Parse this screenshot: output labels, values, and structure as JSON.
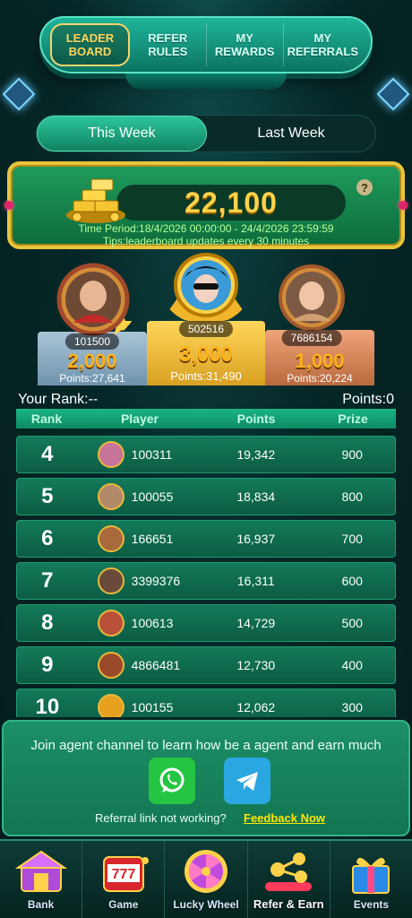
{
  "top_tabs": [
    {
      "label": "LEADER BOARD",
      "active": true
    },
    {
      "label": "REFER RULES",
      "active": false
    },
    {
      "label": "MY REWARDS",
      "active": false
    },
    {
      "label": "MY REFERRALS",
      "active": false
    }
  ],
  "week_toggle": {
    "this_week": "This Week",
    "last_week": "Last Week",
    "selected": "This Week"
  },
  "prize_banner": {
    "amount": "22,100",
    "help": "?",
    "time_period": "Time Period:18/4/2026 00:00:00 - 24/4/2026 23:59:59",
    "tips": "Tips:leaderboard updates every 30 minutes"
  },
  "podium": {
    "first": {
      "id": "502516",
      "prize": "3,000",
      "points": "Points:31,490"
    },
    "second": {
      "id": "101500",
      "prize": "2,000",
      "points": "Points:27,641"
    },
    "third": {
      "id": "7686154",
      "prize": "1,000",
      "points": "Points:20,224"
    }
  },
  "my_rank": {
    "rank_label": "Your Rank:--",
    "points_label": "Points:0"
  },
  "table": {
    "headers": {
      "rank": "Rank",
      "player": "Player",
      "points": "Points",
      "prize": "Prize"
    },
    "rows": [
      {
        "rank": "4",
        "player": "100311",
        "points": "19,342",
        "prize": "900"
      },
      {
        "rank": "5",
        "player": "100055",
        "points": "18,834",
        "prize": "800"
      },
      {
        "rank": "6",
        "player": "166651",
        "points": "16,937",
        "prize": "700"
      },
      {
        "rank": "7",
        "player": "3399376",
        "points": "16,311",
        "prize": "600"
      },
      {
        "rank": "8",
        "player": "100613",
        "points": "14,729",
        "prize": "500"
      },
      {
        "rank": "9",
        "player": "4866481",
        "points": "12,730",
        "prize": "400"
      },
      {
        "rank": "10",
        "player": "100155",
        "points": "12,062",
        "prize": "300"
      }
    ]
  },
  "agent_panel": {
    "message": "Join agent channel to learn how be a agent and earn much",
    "whatsapp_icon": "whatsapp-icon",
    "telegram_icon": "telegram-icon",
    "referral_text": "Referral link not working?",
    "feedback_link": "Feedback Now"
  },
  "bottom_nav": [
    {
      "label": "Bank",
      "icon": "bank-icon"
    },
    {
      "label": "Game",
      "icon": "slot-machine-icon"
    },
    {
      "label": "Lucky Wheel",
      "icon": "wheel-icon"
    },
    {
      "label": "Refer & Earn",
      "icon": "refer-icon",
      "active": true
    },
    {
      "label": "Events",
      "icon": "gift-icon"
    }
  ],
  "colors": {
    "accent_gold": "#ffd24a",
    "panel_green": "#137552",
    "background": "#062828"
  }
}
